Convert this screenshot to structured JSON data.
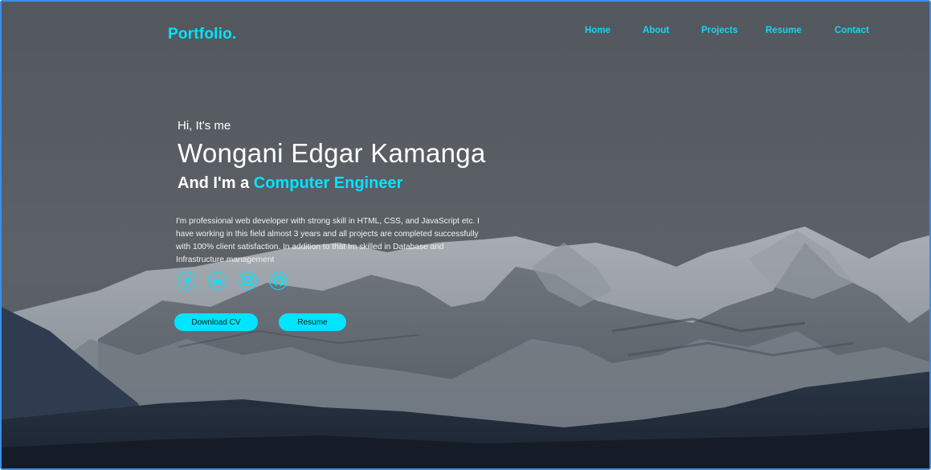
{
  "brand": {
    "logo": "Portfolio."
  },
  "nav": {
    "items": [
      {
        "label": "Home"
      },
      {
        "label": "About"
      },
      {
        "label": "Projects"
      },
      {
        "label": "Resume"
      },
      {
        "label": "Contact"
      }
    ]
  },
  "hero": {
    "greeting": "Hi, It's me",
    "name": "Wongani Edgar Kamanga",
    "role_prefix": "And I'm a",
    "role": "Computer Engineer",
    "description": "I'm professional web developer with strong skill in HTML, CSS, and JavaScript etc. I have working in this field almost 3 years and all projects are completed successfully with 100% client satisfaction. In addition to that Im skilled in Database and Infrastructure management"
  },
  "social": [
    {
      "icon": "facebook-icon"
    },
    {
      "icon": "linkedin-icon"
    },
    {
      "icon": "email-icon"
    },
    {
      "icon": "github-icon"
    }
  ],
  "buttons": {
    "download_cv": "Download CV",
    "resume": "Resume"
  },
  "colors": {
    "accent": "#00e5ff",
    "frame_border": "#3d8ee6"
  }
}
